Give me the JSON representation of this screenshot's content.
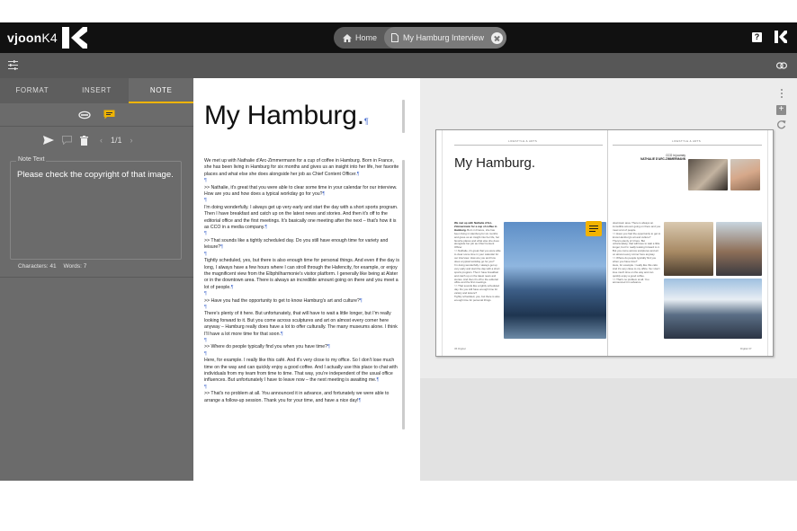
{
  "app": {
    "logo_name": "vjoon",
    "logo_suffix": "K4"
  },
  "breadcrumbs": {
    "home_label": "Home",
    "document_label": "My Hamburg Interview"
  },
  "topbar_icons": {
    "help": "help-icon",
    "help_glyph": "?",
    "brand_mark": "k4-logo-icon",
    "settings": "sliders-icon",
    "link": "link-icon"
  },
  "left_panel": {
    "tabs": [
      {
        "label": "FORMAT",
        "active": false
      },
      {
        "label": "INSERT",
        "active": false
      },
      {
        "label": "NOTE",
        "active": true
      }
    ],
    "note_types": [
      "highlight-note-icon",
      "comment-note-icon"
    ],
    "note_tools": {
      "send": "send-icon",
      "reply": "reply-icon",
      "delete": "trash-icon",
      "pager": "1/1"
    },
    "note_field": {
      "label": "Note Text",
      "value": "Please check the copyright of that image."
    },
    "stats": {
      "characters": "Characters: 41",
      "words": "Words: 7"
    }
  },
  "editor": {
    "title": "My Hamburg.",
    "paragraphs": [
      "We met up with Nathalie d'Arc-Zimmermann for a cup of coffee in Hamburg. Born in France, she has been living in Hamburg for six months and gives us an insight into her life, her favorite places and what else she does alongside her job as Chief Content Officer.",
      "",
      ">> Nathalie, it's great that you were able to clear some time in your calendar for our interview. How are you and how does a typical workday go for you?",
      "",
      "I'm doing wonderfully. I always get up very early and start the day with a short sports program. Then I have breakfast and catch up on the latest news and stories. And then it's off to the editorial office and the first meetings. It's basically one meeting after the next – that's how it is as CCO in a media company.",
      "",
      ">> That sounds like a tightly scheduled day. Do you still have enough time for variety and leisure?",
      "",
      "Tightly scheduled, yes, but there is also enough time for personal things. And even if the day is long, I always have a few hours where I can stroll through the Hafencity, for example, or enjoy the magnificent view from the Elbphilharmonie's visitor platform. I generally like being at Alster or in the downtown area. There is always an incredible amount going on there and you meet a lot of people.",
      "",
      ">> Have you had the opportunity to get to know Hamburg's art and culture?",
      "",
      "There's plenty of it here. But unfortunately, that will have to wait a little longer, but I'm really looking forward to it. But you come across sculptures and art on almost every corner here anyway – Hamburg really does have a lot to offer culturally. The many museums alone. I think I'll have a lot more time for that soon.",
      "",
      ">> Where do people typically find you when you have time?",
      "",
      "Here, for example. I really like this café. And it's very close to my office. So I don't lose much time on the way and can quickly enjoy a good coffee. And I actually use this place to chat with individuals from my team from time to time. That way, you're independent of the usual office influences. But unfortunately I have to leave now – the next meeting is awaiting me.",
      "",
      ">> That's no problem at all. You announced it in advance, and fortunately we were able to arrange a follow-up session. Thank you for your time, and have a nice day!"
    ]
  },
  "preview": {
    "toolbar": {
      "menu": "more-vertical-icon",
      "add": "add-box-icon",
      "refresh": "refresh-icon"
    },
    "spread": {
      "running_header_left": "LIFESTYLE & ARTS",
      "running_header_right": "LIFESTYLE & ARTS",
      "title": "My Hamburg.",
      "kicker_line1": "CCO in journey",
      "kicker_line2": "NATHALIE D'ARC-ZIMMERMANN",
      "folio_left": "36  Digital",
      "folio_right": "Digital  37",
      "note_marker": "comment-note-icon"
    }
  },
  "colors": {
    "topbar": "#111111",
    "subbar": "#575757",
    "panel": "#6b6b6b",
    "accent": "#f0b400",
    "pilcrow": "#4a6fd0"
  }
}
